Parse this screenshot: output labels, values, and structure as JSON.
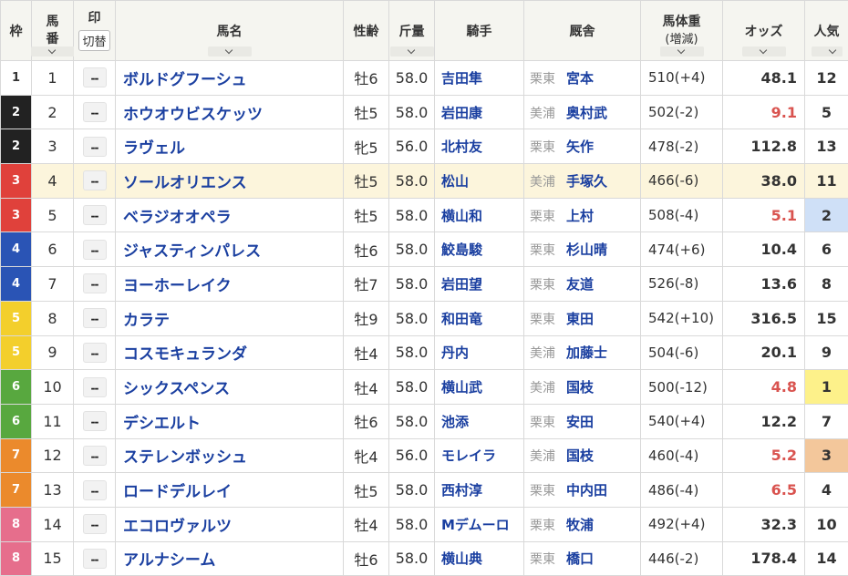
{
  "header": {
    "waku": "枠",
    "umaban_top": "馬",
    "umaban_bottom": "番",
    "mark": "印",
    "mark_toggle": "切替",
    "horse": "馬名",
    "sexage": "性齢",
    "kinryo": "斤量",
    "jockey": "騎手",
    "stable": "厩舎",
    "weight": "馬体重",
    "weight_sub": "(増減)",
    "odds": "オッズ",
    "popularity": "人気"
  },
  "colors": {
    "waku": {
      "1": "#ffffff",
      "2": "#222222",
      "3": "#e0413b",
      "4": "#2a54b5",
      "5": "#f3cf2c",
      "6": "#58a83f",
      "7": "#eb8a2c",
      "8": "#e66e8c"
    },
    "waku_text": {
      "1": "#333333",
      "2": "#ffffff",
      "3": "#ffffff",
      "4": "#ffffff",
      "5": "#ffffff",
      "6": "#ffffff",
      "7": "#ffffff",
      "8": "#ffffff"
    },
    "pop1": "#fdf18a",
    "pop2": "#cfe0f7",
    "pop3": "#f3c79b",
    "highlight_row": "#fcf5dc"
  },
  "rows": [
    {
      "waku": "1",
      "umaban": "1",
      "mark": "--",
      "horse": "ボルドグフーシュ",
      "sexage": "牡6",
      "kinryo": "58.0",
      "jockey": "吉田隼",
      "region": "栗東",
      "trainer": "宮本",
      "weight": "510(+4)",
      "odds": "48.1",
      "popularity": "12"
    },
    {
      "waku": "2",
      "umaban": "2",
      "mark": "--",
      "horse": "ホウオウビスケッツ",
      "sexage": "牡5",
      "kinryo": "58.0",
      "jockey": "岩田康",
      "region": "美浦",
      "trainer": "奥村武",
      "weight": "502(-2)",
      "odds": "9.1",
      "popularity": "5"
    },
    {
      "waku": "2",
      "umaban": "3",
      "mark": "--",
      "horse": "ラヴェル",
      "sexage": "牝5",
      "kinryo": "56.0",
      "jockey": "北村友",
      "region": "栗東",
      "trainer": "矢作",
      "weight": "478(-2)",
      "odds": "112.8",
      "popularity": "13"
    },
    {
      "waku": "3",
      "umaban": "4",
      "mark": "--",
      "horse": "ソールオリエンス",
      "sexage": "牡5",
      "kinryo": "58.0",
      "jockey": "松山",
      "region": "美浦",
      "trainer": "手塚久",
      "weight": "466(-6)",
      "odds": "38.0",
      "popularity": "11"
    },
    {
      "waku": "3",
      "umaban": "5",
      "mark": "--",
      "horse": "ベラジオオペラ",
      "sexage": "牡5",
      "kinryo": "58.0",
      "jockey": "横山和",
      "region": "栗東",
      "trainer": "上村",
      "weight": "508(-4)",
      "odds": "5.1",
      "popularity": "2"
    },
    {
      "waku": "4",
      "umaban": "6",
      "mark": "--",
      "horse": "ジャスティンパレス",
      "sexage": "牡6",
      "kinryo": "58.0",
      "jockey": "鮫島駿",
      "region": "栗東",
      "trainer": "杉山晴",
      "weight": "474(+6)",
      "odds": "10.4",
      "popularity": "6"
    },
    {
      "waku": "4",
      "umaban": "7",
      "mark": "--",
      "horse": "ヨーホーレイク",
      "sexage": "牡7",
      "kinryo": "58.0",
      "jockey": "岩田望",
      "region": "栗東",
      "trainer": "友道",
      "weight": "526(-8)",
      "odds": "13.6",
      "popularity": "8"
    },
    {
      "waku": "5",
      "umaban": "8",
      "mark": "--",
      "horse": "カラテ",
      "sexage": "牡9",
      "kinryo": "58.0",
      "jockey": "和田竜",
      "region": "栗東",
      "trainer": "東田",
      "weight": "542(+10)",
      "odds": "316.5",
      "popularity": "15"
    },
    {
      "waku": "5",
      "umaban": "9",
      "mark": "--",
      "horse": "コスモキュランダ",
      "sexage": "牡4",
      "kinryo": "58.0",
      "jockey": "丹内",
      "region": "美浦",
      "trainer": "加藤士",
      "weight": "504(-6)",
      "odds": "20.1",
      "popularity": "9"
    },
    {
      "waku": "6",
      "umaban": "10",
      "mark": "--",
      "horse": "シックスペンス",
      "sexage": "牡4",
      "kinryo": "58.0",
      "jockey": "横山武",
      "region": "美浦",
      "trainer": "国枝",
      "weight": "500(-12)",
      "odds": "4.8",
      "popularity": "1"
    },
    {
      "waku": "6",
      "umaban": "11",
      "mark": "--",
      "horse": "デシエルト",
      "sexage": "牡6",
      "kinryo": "58.0",
      "jockey": "池添",
      "region": "栗東",
      "trainer": "安田",
      "weight": "540(+4)",
      "odds": "12.2",
      "popularity": "7"
    },
    {
      "waku": "7",
      "umaban": "12",
      "mark": "--",
      "horse": "ステレンボッシュ",
      "sexage": "牝4",
      "kinryo": "56.0",
      "jockey": "モレイラ",
      "region": "美浦",
      "trainer": "国枝",
      "weight": "460(-4)",
      "odds": "5.2",
      "popularity": "3"
    },
    {
      "waku": "7",
      "umaban": "13",
      "mark": "--",
      "horse": "ロードデルレイ",
      "sexage": "牡5",
      "kinryo": "58.0",
      "jockey": "西村淳",
      "region": "栗東",
      "trainer": "中内田",
      "weight": "486(-4)",
      "odds": "6.5",
      "popularity": "4"
    },
    {
      "waku": "8",
      "umaban": "14",
      "mark": "--",
      "horse": "エコロヴァルツ",
      "sexage": "牡4",
      "kinryo": "58.0",
      "jockey": "Mデムーロ",
      "region": "栗東",
      "trainer": "牧浦",
      "weight": "492(+4)",
      "odds": "32.3",
      "popularity": "10"
    },
    {
      "waku": "8",
      "umaban": "15",
      "mark": "--",
      "horse": "アルナシーム",
      "sexage": "牡6",
      "kinryo": "58.0",
      "jockey": "横山典",
      "region": "栗東",
      "trainer": "橋口",
      "weight": "446(-2)",
      "odds": "178.4",
      "popularity": "14"
    }
  ]
}
